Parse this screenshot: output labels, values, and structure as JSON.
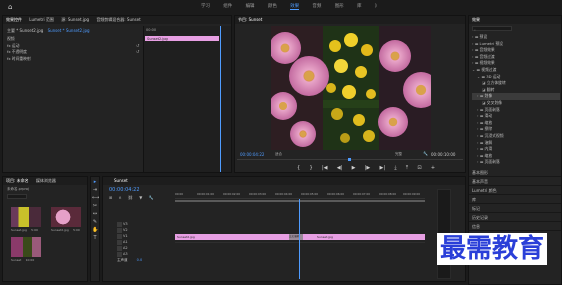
{
  "topbar": {
    "home_icon": "home-icon",
    "workspaces": [
      "学习",
      "组件",
      "编辑",
      "颜色",
      "效果",
      "音频",
      "图形",
      "库",
      "》"
    ],
    "active_workspace": "效果"
  },
  "source_panel": {
    "tabs": [
      "效果控件",
      "Lumetri 范围",
      "源: Sunset.jpg",
      "音频剪辑混合器: Sunset"
    ],
    "header": "主要 * Sunset2.jpg",
    "clip_label": "Sunset * Sunset2.jpg",
    "sections": [
      "视频",
      "fx 运动",
      "fx 不透明度",
      "fx 时间重映射"
    ],
    "mini_timecode": "00:00",
    "mini_clip": "Sunset2.jpg"
  },
  "program_monitor": {
    "tab": "节目: Sunset",
    "timecode_left": "00:00:04:22",
    "fit": "适合",
    "quality": "完整",
    "timecode_right": "00:00:10:00",
    "controls": [
      "{",
      "}",
      "|◀",
      "◀|",
      "▶",
      "|▶",
      "▶|",
      "⤓",
      "⤒",
      "⊡",
      "+"
    ]
  },
  "effects_panel": {
    "title": "效果",
    "items": [
      "预设",
      "Lumetri 预设",
      "音频效果",
      "音频过渡",
      "视频效果",
      "视频过渡",
      "3D 运动",
      "立方体旋转",
      "翻转",
      "划像",
      "交叉划像",
      "页面剥落",
      "滑动",
      "缩放",
      "擦除",
      "沉浸式视频",
      "溶解",
      "内滑",
      "缩放",
      "页面剥落"
    ],
    "highlighted_index": 9,
    "sections": [
      "基本图形",
      "基本声音",
      "Lumetri 颜色",
      "库",
      "标记",
      "历史记录",
      "信息"
    ]
  },
  "project_panel": {
    "tabs": [
      "项目: 未命名",
      "媒体浏览器"
    ],
    "path": "未命名.prproj",
    "items": [
      {
        "name": "Sunset.jpg",
        "dur": "5:00"
      },
      {
        "name": "Sunset2.jpg",
        "dur": "5:00"
      },
      {
        "name": "Sunset",
        "dur": "10:00"
      }
    ]
  },
  "timeline": {
    "tab": "Sunset",
    "timecode": "00:00:04:22",
    "ruler": [
      "00:00",
      "00:00:01:00",
      "00:00:02:00",
      "00:00:03:00",
      "00:00:04:00",
      "00:00:05:00",
      "00:00:06:00",
      "00:00:07:00",
      "00:00:08:00",
      "00:00:09:00"
    ],
    "tracks": [
      "V3",
      "V2",
      "V1",
      "A1",
      "A2",
      "A3"
    ],
    "master": "主声道",
    "master_val": "0.0",
    "clips": [
      "Sunset2.jpg",
      "交叉溶解",
      "Sunset.jpg"
    ]
  },
  "watermark": "最需教育",
  "colors": {
    "clip_pink": "#e79fe3",
    "playhead_blue": "#4f9cff",
    "watermark_blue": "#2a3fd8"
  }
}
